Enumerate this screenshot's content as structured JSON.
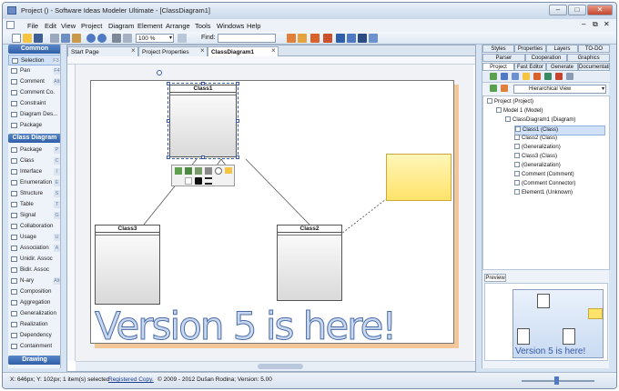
{
  "window": {
    "title": "Project () - Software Ideas Modeler Ultimate - [ClassDiagram1]"
  },
  "menu": [
    "File",
    "Edit",
    "View",
    "Project",
    "Diagram",
    "Element",
    "Arrange",
    "Tools",
    "Windows",
    "Help"
  ],
  "toolbar": {
    "zoom": "100 %",
    "find_label": "Find:"
  },
  "left_panel": {
    "common_header": "Common",
    "common_items": [
      {
        "label": "Selection",
        "key": "F3"
      },
      {
        "label": "Pan",
        "key": "F4"
      },
      {
        "label": "Comment",
        "key": "Alt+Shift+"
      },
      {
        "label": "Comment Co.",
        "key": ""
      },
      {
        "label": "Constraint",
        "key": ""
      },
      {
        "label": "Diagram Des...",
        "key": ""
      },
      {
        "label": "Package",
        "key": ""
      }
    ],
    "class_header": "Class Diagram",
    "class_items": [
      {
        "label": "Package",
        "key": "P"
      },
      {
        "label": "Class",
        "key": "C"
      },
      {
        "label": "Interface",
        "key": "I"
      },
      {
        "label": "Enumeration",
        "key": "E"
      },
      {
        "label": "Structure",
        "key": "S"
      },
      {
        "label": "Table",
        "key": "T"
      },
      {
        "label": "Signal",
        "key": "G"
      },
      {
        "label": "Collaboration",
        "key": ""
      },
      {
        "label": "Usage",
        "key": "U"
      },
      {
        "label": "Association",
        "key": "A"
      },
      {
        "label": "Unidir. Assoc",
        "key": ""
      },
      {
        "label": "Bidir. Assoc",
        "key": ""
      },
      {
        "label": "N-ary",
        "key": "Alt+Shift+"
      },
      {
        "label": "Composition",
        "key": ""
      },
      {
        "label": "Aggregation",
        "key": ""
      },
      {
        "label": "Generalization",
        "key": ""
      },
      {
        "label": "Realization",
        "key": ""
      },
      {
        "label": "Dependency",
        "key": ""
      },
      {
        "label": "Containment",
        "key": ""
      }
    ],
    "drawing_header": "Drawing"
  },
  "editor_tabs": [
    {
      "label": "Start Page"
    },
    {
      "label": "Project Properties"
    },
    {
      "label": "ClassDiagram1"
    }
  ],
  "diagram": {
    "classes": [
      "Class1",
      "Class3",
      "Class2"
    ],
    "banner": "Version 5 is here!"
  },
  "right_panel": {
    "tabs_row1": [
      "Styles",
      "Properties",
      "Layers",
      "TO-DO"
    ],
    "tabs_row2": [
      "Parser",
      "Cooperation",
      "Graphics"
    ],
    "tabs_row3": [
      "Project",
      "Fast Editor",
      "Generate",
      "Documentation"
    ],
    "view_select": "Hierarchical View",
    "tree": [
      {
        "label": "Project (Project)",
        "level": 0
      },
      {
        "label": "Model 1 (Model)",
        "level": 1
      },
      {
        "label": "ClassDiagram1 (Diagram)",
        "level": 2
      },
      {
        "label": "Class1 (Class)",
        "level": 3,
        "selected": true
      },
      {
        "label": "Class2 (Class)",
        "level": 3
      },
      {
        "label": "(Generalization)",
        "level": 3
      },
      {
        "label": "Class3 (Class)",
        "level": 3
      },
      {
        "label": "(Generalization)",
        "level": 3
      },
      {
        "label": "Comment (Comment)",
        "level": 3
      },
      {
        "label": "(Comment Connector)",
        "level": 3
      },
      {
        "label": "Element1 (Unknown)",
        "level": 3
      }
    ],
    "preview_tab": "Preview",
    "preview_text": "Version 5 is here!"
  },
  "status": {
    "position": "X: 646px; Y: 102px; 1 item(s) selected",
    "link": "Registered Copy.",
    "copyright": "© 2009 - 2012 Dušan Rodina; Version: 5.00"
  },
  "colors": {
    "accent": "#2f5fa8",
    "note": "#ffe97a",
    "page_shadow": "#f2c89a"
  }
}
